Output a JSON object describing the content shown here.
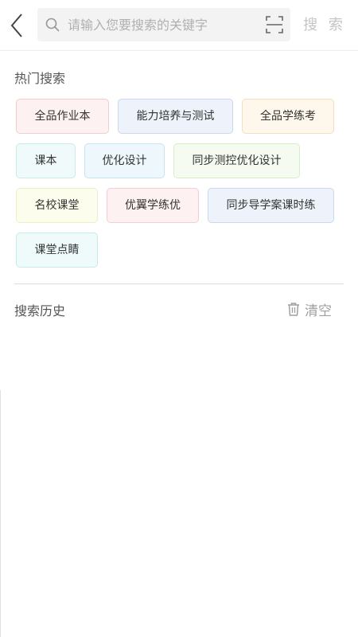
{
  "search": {
    "placeholder": "请输入您要搜索的关键字",
    "value": "",
    "button_label": "搜 索"
  },
  "icons": {
    "back": "back-arrow-icon",
    "search": "search-icon",
    "scan": "scan-icon",
    "trash": "trash-icon"
  },
  "hot_search": {
    "title": "热门搜索",
    "tags": [
      {
        "label": "全品作业本",
        "bg": "#fdf1f1",
        "border": "#f3cdcd"
      },
      {
        "label": "能力培养与测试",
        "bg": "#eef3fb",
        "border": "#c9d8ee"
      },
      {
        "label": "全品学练考",
        "bg": "#fdf7ec",
        "border": "#f1dfbd"
      },
      {
        "label": "课本",
        "bg": "#f0fafa",
        "border": "#c9ebea"
      },
      {
        "label": "优化设计",
        "bg": "#eef7fc",
        "border": "#c8e3f2"
      },
      {
        "label": "同步测控优化设计",
        "bg": "#f5fbf1",
        "border": "#d7efc8"
      },
      {
        "label": "名校课堂",
        "bg": "#fdfdee",
        "border": "#eeeec7"
      },
      {
        "label": "优翼学练优",
        "bg": "#fdf1f2",
        "border": "#f3cdd1"
      },
      {
        "label": "同步导学案课时练",
        "bg": "#eef3fb",
        "border": "#c9d8ee"
      },
      {
        "label": "课堂点睛",
        "bg": "#effafa",
        "border": "#c3ecea"
      }
    ]
  },
  "history": {
    "title": "搜索历史",
    "clear_label": "清空",
    "items": []
  }
}
